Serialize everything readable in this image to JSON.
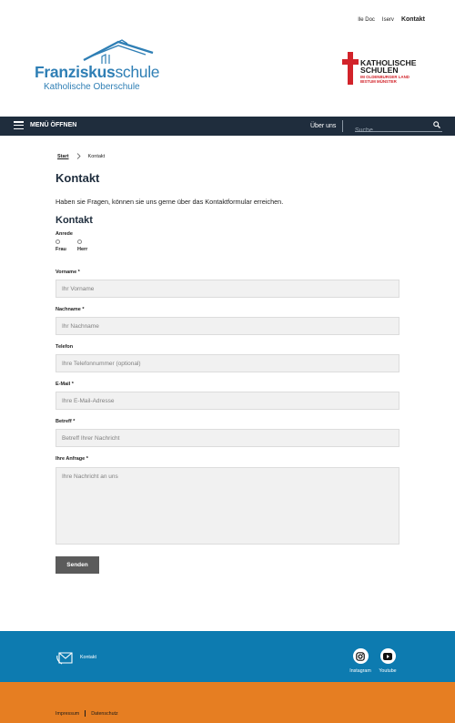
{
  "topbar": {
    "link1": "Ile Doc",
    "link2": "Iserv",
    "link3": "Kontakt"
  },
  "logo_left": {
    "name_bold": "Franziskus",
    "name_light": "schule",
    "subtitle": "Katholische Oberschule"
  },
  "logo_right": {
    "line1": "KATHOLISCHE",
    "line2": "SCHULEN",
    "line3": "IM OLDENBURGER LAND",
    "line4": "BISTUM MÜNSTER"
  },
  "nav": {
    "menu_label": "MENÜ ÖFFNEN",
    "link": "Über uns",
    "search_placeholder": "Suche"
  },
  "breadcrumb": {
    "home": "Start",
    "current": "Kontakt"
  },
  "page": {
    "title": "Kontakt",
    "intro": "Haben sie Fragen, können sie uns gerne über das Kontaktformular erreichen.",
    "form_title": "Kontakt"
  },
  "form": {
    "anrede_label": "Anrede",
    "anrede_options": [
      "Frau",
      "Herr"
    ],
    "vorname_label": "Vorname *",
    "vorname_placeholder": "Ihr Vorname",
    "nachname_label": "Nachname *",
    "nachname_placeholder": "Ihr Nachname",
    "telefon_label": "Telefon",
    "telefon_placeholder": "Ihre Telefonnummer (optional)",
    "email_label": "E-Mail *",
    "email_placeholder": "Ihre E-Mail-Adresse",
    "betreff_label": "Betreff *",
    "betreff_placeholder": "Betreff Ihrer Nachricht",
    "anfrage_label": "Ihre Anfrage *",
    "anfrage_placeholder": "Ihre Nachricht an uns",
    "submit": "Senden"
  },
  "footer": {
    "contact": "Kontakt",
    "instagram": "Instagram",
    "youtube": "Youtube",
    "impressum": "Impressum",
    "datenschutz": "Datenschutz"
  },
  "colors": {
    "navbar": "#1f2d3d",
    "brand_blue": "#2f7fb5",
    "footer_blue": "#0d7bb0",
    "footer_orange": "#e67e22",
    "accent_red": "#d2232a",
    "button": "#5b5b5b"
  }
}
